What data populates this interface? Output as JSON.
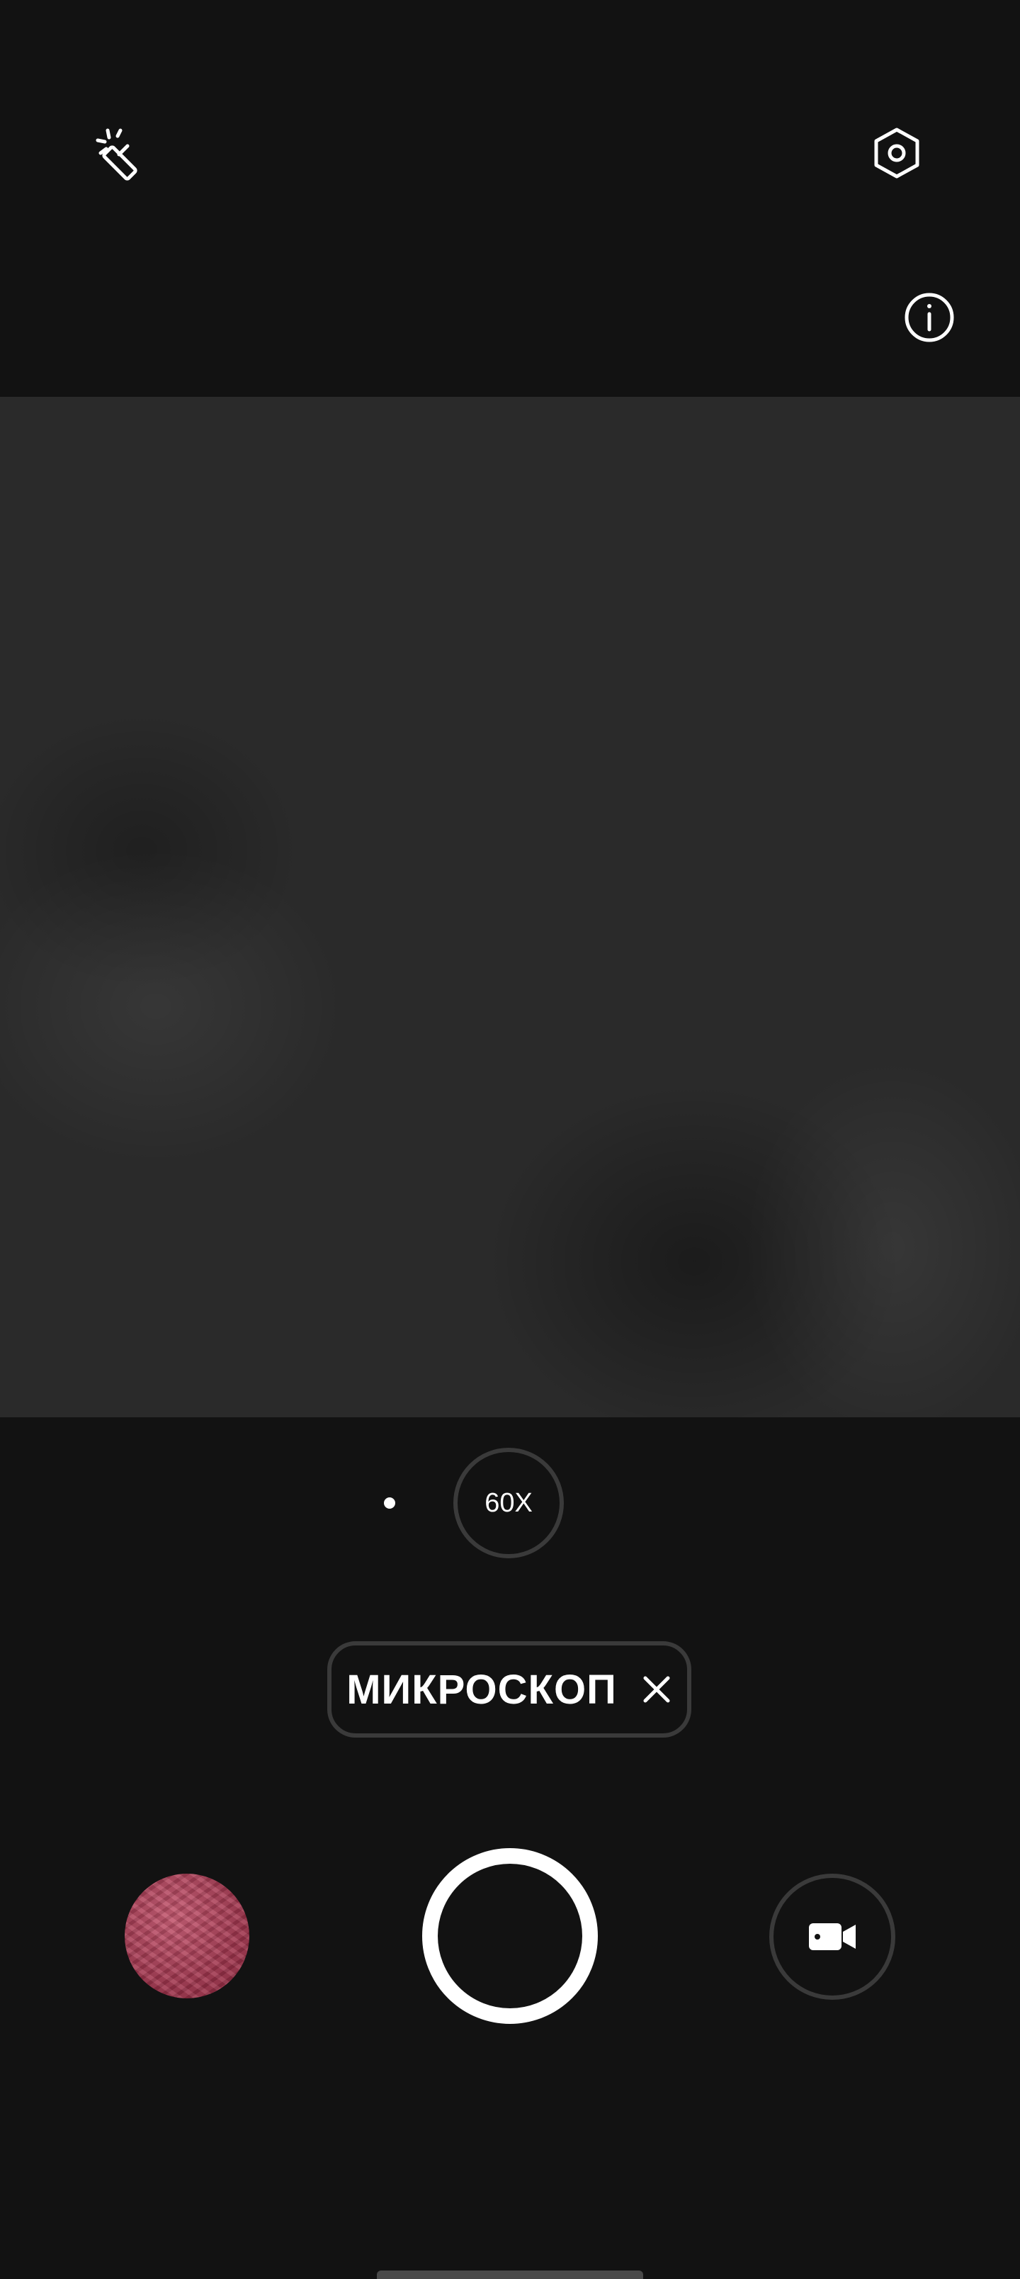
{
  "camera": {
    "zoom": {
      "level_label": "60X"
    },
    "mode": {
      "label": "МИКРОСКОП"
    }
  },
  "icons": {
    "magic_wand": "magic-wand-icon",
    "settings": "settings-hexagon-icon",
    "info": "info-icon",
    "close": "close-icon",
    "video": "video-camera-icon",
    "gallery": "gallery-thumbnail"
  },
  "colors": {
    "background": "#121212",
    "viewfinder": "#2a2a2a",
    "ring": "#3a3a3a",
    "foreground": "#ffffff",
    "thumbnail": "#b84660"
  }
}
